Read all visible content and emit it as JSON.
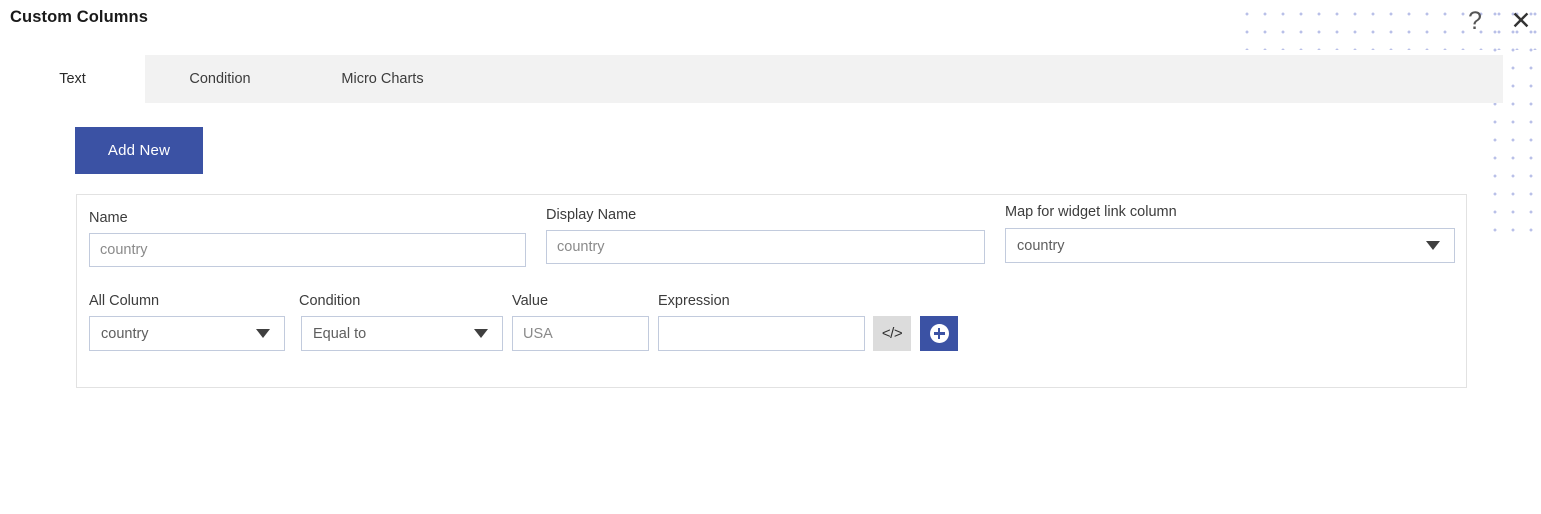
{
  "dialog": {
    "title": "Custom Columns",
    "help_icon": "?",
    "close_icon": "✕"
  },
  "tabs": [
    {
      "id": "text",
      "label": "Text",
      "active": true
    },
    {
      "id": "condition",
      "label": "Condition",
      "active": false
    },
    {
      "id": "micro-charts",
      "label": "Micro Charts",
      "active": false
    }
  ],
  "toolbar": {
    "add_new_label": "Add New"
  },
  "form": {
    "row1": {
      "name": {
        "label": "Name",
        "value": "country",
        "placeholder": "country"
      },
      "display_name": {
        "label": "Display Name",
        "value": "country",
        "placeholder": "country"
      },
      "map_widget_link": {
        "label": "Map for widget link column",
        "value": "country",
        "caret_icon": "chevron-down-icon"
      }
    },
    "row2": {
      "all_column": {
        "label": "All Column",
        "value": "country",
        "caret_icon": "chevron-down-icon"
      },
      "condition": {
        "label": "Condition",
        "value": "Equal to",
        "caret_icon": "chevron-down-icon"
      },
      "value": {
        "label": "Value",
        "value": "USA",
        "placeholder": "USA"
      },
      "expression": {
        "label": "Expression",
        "value": "",
        "placeholder": ""
      },
      "code_button": {
        "label": "</>",
        "icon": "code-icon"
      },
      "add_button": {
        "icon": "plus-circle-icon"
      }
    }
  },
  "colors": {
    "accent": "#3b52a4",
    "tabbar_bg": "#f2f2f2",
    "panel_border": "#e2e2e2",
    "input_border": "#c2cbdd",
    "dot_pattern": "#b9c0e8"
  }
}
